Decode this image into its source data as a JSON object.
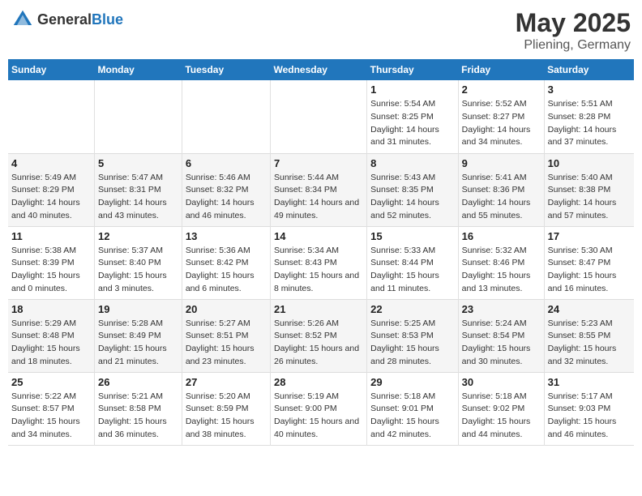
{
  "header": {
    "logo_general": "General",
    "logo_blue": "Blue",
    "month": "May 2025",
    "location": "Pliening, Germany"
  },
  "weekdays": [
    "Sunday",
    "Monday",
    "Tuesday",
    "Wednesday",
    "Thursday",
    "Friday",
    "Saturday"
  ],
  "weeks": [
    [
      {
        "day": "",
        "sunrise": "",
        "sunset": "",
        "daylight": ""
      },
      {
        "day": "",
        "sunrise": "",
        "sunset": "",
        "daylight": ""
      },
      {
        "day": "",
        "sunrise": "",
        "sunset": "",
        "daylight": ""
      },
      {
        "day": "",
        "sunrise": "",
        "sunset": "",
        "daylight": ""
      },
      {
        "day": "1",
        "sunrise": "Sunrise: 5:54 AM",
        "sunset": "Sunset: 8:25 PM",
        "daylight": "Daylight: 14 hours and 31 minutes."
      },
      {
        "day": "2",
        "sunrise": "Sunrise: 5:52 AM",
        "sunset": "Sunset: 8:27 PM",
        "daylight": "Daylight: 14 hours and 34 minutes."
      },
      {
        "day": "3",
        "sunrise": "Sunrise: 5:51 AM",
        "sunset": "Sunset: 8:28 PM",
        "daylight": "Daylight: 14 hours and 37 minutes."
      }
    ],
    [
      {
        "day": "4",
        "sunrise": "Sunrise: 5:49 AM",
        "sunset": "Sunset: 8:29 PM",
        "daylight": "Daylight: 14 hours and 40 minutes."
      },
      {
        "day": "5",
        "sunrise": "Sunrise: 5:47 AM",
        "sunset": "Sunset: 8:31 PM",
        "daylight": "Daylight: 14 hours and 43 minutes."
      },
      {
        "day": "6",
        "sunrise": "Sunrise: 5:46 AM",
        "sunset": "Sunset: 8:32 PM",
        "daylight": "Daylight: 14 hours and 46 minutes."
      },
      {
        "day": "7",
        "sunrise": "Sunrise: 5:44 AM",
        "sunset": "Sunset: 8:34 PM",
        "daylight": "Daylight: 14 hours and 49 minutes."
      },
      {
        "day": "8",
        "sunrise": "Sunrise: 5:43 AM",
        "sunset": "Sunset: 8:35 PM",
        "daylight": "Daylight: 14 hours and 52 minutes."
      },
      {
        "day": "9",
        "sunrise": "Sunrise: 5:41 AM",
        "sunset": "Sunset: 8:36 PM",
        "daylight": "Daylight: 14 hours and 55 minutes."
      },
      {
        "day": "10",
        "sunrise": "Sunrise: 5:40 AM",
        "sunset": "Sunset: 8:38 PM",
        "daylight": "Daylight: 14 hours and 57 minutes."
      }
    ],
    [
      {
        "day": "11",
        "sunrise": "Sunrise: 5:38 AM",
        "sunset": "Sunset: 8:39 PM",
        "daylight": "Daylight: 15 hours and 0 minutes."
      },
      {
        "day": "12",
        "sunrise": "Sunrise: 5:37 AM",
        "sunset": "Sunset: 8:40 PM",
        "daylight": "Daylight: 15 hours and 3 minutes."
      },
      {
        "day": "13",
        "sunrise": "Sunrise: 5:36 AM",
        "sunset": "Sunset: 8:42 PM",
        "daylight": "Daylight: 15 hours and 6 minutes."
      },
      {
        "day": "14",
        "sunrise": "Sunrise: 5:34 AM",
        "sunset": "Sunset: 8:43 PM",
        "daylight": "Daylight: 15 hours and 8 minutes."
      },
      {
        "day": "15",
        "sunrise": "Sunrise: 5:33 AM",
        "sunset": "Sunset: 8:44 PM",
        "daylight": "Daylight: 15 hours and 11 minutes."
      },
      {
        "day": "16",
        "sunrise": "Sunrise: 5:32 AM",
        "sunset": "Sunset: 8:46 PM",
        "daylight": "Daylight: 15 hours and 13 minutes."
      },
      {
        "day": "17",
        "sunrise": "Sunrise: 5:30 AM",
        "sunset": "Sunset: 8:47 PM",
        "daylight": "Daylight: 15 hours and 16 minutes."
      }
    ],
    [
      {
        "day": "18",
        "sunrise": "Sunrise: 5:29 AM",
        "sunset": "Sunset: 8:48 PM",
        "daylight": "Daylight: 15 hours and 18 minutes."
      },
      {
        "day": "19",
        "sunrise": "Sunrise: 5:28 AM",
        "sunset": "Sunset: 8:49 PM",
        "daylight": "Daylight: 15 hours and 21 minutes."
      },
      {
        "day": "20",
        "sunrise": "Sunrise: 5:27 AM",
        "sunset": "Sunset: 8:51 PM",
        "daylight": "Daylight: 15 hours and 23 minutes."
      },
      {
        "day": "21",
        "sunrise": "Sunrise: 5:26 AM",
        "sunset": "Sunset: 8:52 PM",
        "daylight": "Daylight: 15 hours and 26 minutes."
      },
      {
        "day": "22",
        "sunrise": "Sunrise: 5:25 AM",
        "sunset": "Sunset: 8:53 PM",
        "daylight": "Daylight: 15 hours and 28 minutes."
      },
      {
        "day": "23",
        "sunrise": "Sunrise: 5:24 AM",
        "sunset": "Sunset: 8:54 PM",
        "daylight": "Daylight: 15 hours and 30 minutes."
      },
      {
        "day": "24",
        "sunrise": "Sunrise: 5:23 AM",
        "sunset": "Sunset: 8:55 PM",
        "daylight": "Daylight: 15 hours and 32 minutes."
      }
    ],
    [
      {
        "day": "25",
        "sunrise": "Sunrise: 5:22 AM",
        "sunset": "Sunset: 8:57 PM",
        "daylight": "Daylight: 15 hours and 34 minutes."
      },
      {
        "day": "26",
        "sunrise": "Sunrise: 5:21 AM",
        "sunset": "Sunset: 8:58 PM",
        "daylight": "Daylight: 15 hours and 36 minutes."
      },
      {
        "day": "27",
        "sunrise": "Sunrise: 5:20 AM",
        "sunset": "Sunset: 8:59 PM",
        "daylight": "Daylight: 15 hours and 38 minutes."
      },
      {
        "day": "28",
        "sunrise": "Sunrise: 5:19 AM",
        "sunset": "Sunset: 9:00 PM",
        "daylight": "Daylight: 15 hours and 40 minutes."
      },
      {
        "day": "29",
        "sunrise": "Sunrise: 5:18 AM",
        "sunset": "Sunset: 9:01 PM",
        "daylight": "Daylight: 15 hours and 42 minutes."
      },
      {
        "day": "30",
        "sunrise": "Sunrise: 5:18 AM",
        "sunset": "Sunset: 9:02 PM",
        "daylight": "Daylight: 15 hours and 44 minutes."
      },
      {
        "day": "31",
        "sunrise": "Sunrise: 5:17 AM",
        "sunset": "Sunset: 9:03 PM",
        "daylight": "Daylight: 15 hours and 46 minutes."
      }
    ]
  ]
}
